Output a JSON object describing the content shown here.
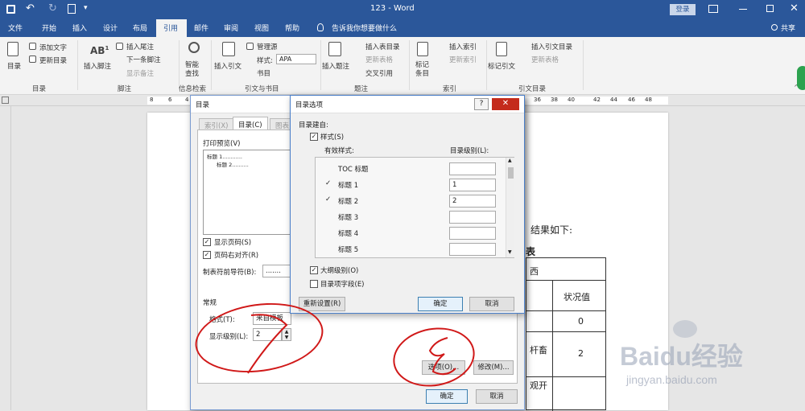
{
  "title": "123 - Word",
  "login_label": "登录",
  "share_label": "共享",
  "tabs": [
    "文件",
    "开始",
    "插入",
    "设计",
    "布局",
    "引用",
    "邮件",
    "审阅",
    "视图",
    "帮助"
  ],
  "tell_me": "告诉我你想要做什么",
  "ribbon": {
    "toc_label": "目录",
    "add_text": "添加文字",
    "update_toc": "更新目录",
    "group_toc": "目录",
    "insert_footnote": "插入脚注",
    "insert_endnote": "插入尾注",
    "next_footnote": "下一条脚注",
    "show_notes": "显示备注",
    "group_footnote": "脚注",
    "smart_lookup": "智能查找",
    "group_info": "信息检索",
    "insert_citation": "插入引文",
    "manage_sources": "管理源",
    "style_label": "样式:",
    "style_value": "APA",
    "bibliography": "书目",
    "group_citation": "引文与书目",
    "insert_caption": "插入题注",
    "insert_table_caption": "插入表目录",
    "update_table": "更新表格",
    "cross_ref": "交叉引用",
    "group_caption": "题注",
    "mark_entry": "标记条目",
    "insert_index": "插入索引",
    "update_index": "更新索引",
    "group_index": "索引",
    "mark_citation": "标记引文",
    "insert_table_auth": "插入引文目录",
    "update_table_auth": "更新表格",
    "group_authorities": "引文目录"
  },
  "ruler_left": [
    "8",
    "6",
    "4"
  ],
  "ruler_right": [
    "36",
    "38",
    "40",
    "42",
    "44",
    "46",
    "48"
  ],
  "document": {
    "text1": "结果如下:",
    "text2": "表",
    "cell1": "西",
    "cell2": "状况值",
    "cell3": "0",
    "cell4": "杆畜",
    "cell5": "2",
    "cell6": "观开"
  },
  "toc_dialog": {
    "title": "目录",
    "tab_index": "索引(X)",
    "tab_toc": "目录(C)",
    "tab_figures": "图表",
    "print_preview": "打印预览(V)",
    "preview_h1": "标题 1............",
    "preview_h2": "标题 2..........",
    "show_page_numbers": "显示页码(S)",
    "right_align": "页码右对齐(R)",
    "tab_leader_label": "制表符前导符(B):",
    "tab_leader_value": ".......",
    "general": "常规",
    "formats_label": "格式(T):",
    "formats_value": "来自模板",
    "levels_label": "显示级别(L):",
    "levels_value": "2",
    "options_btn": "选项(O)...",
    "modify_btn": "修改(M)...",
    "ok": "确定",
    "cancel": "取消"
  },
  "options_dialog": {
    "title": "目录选项",
    "build_from": "目录建自:",
    "styles": "样式(S)",
    "available_styles": "有效样式:",
    "toc_level": "目录级别(L):",
    "rows": [
      {
        "name": "TOC 标题",
        "level": "",
        "checked": false
      },
      {
        "name": "标题 1",
        "level": "1",
        "checked": true
      },
      {
        "name": "标题 2",
        "level": "2",
        "checked": true
      },
      {
        "name": "标题 3",
        "level": "",
        "checked": false
      },
      {
        "name": "标题 4",
        "level": "",
        "checked": false
      },
      {
        "name": "标题 5",
        "level": "",
        "checked": false
      }
    ],
    "outline_levels": "大纲级别(O)",
    "entry_fields": "目录项字段(E)",
    "reset": "重新设置(R)",
    "ok": "确定",
    "cancel": "取消"
  },
  "watermark": {
    "logo": "Baidu经验",
    "url": "jingyan.baidu.com"
  }
}
